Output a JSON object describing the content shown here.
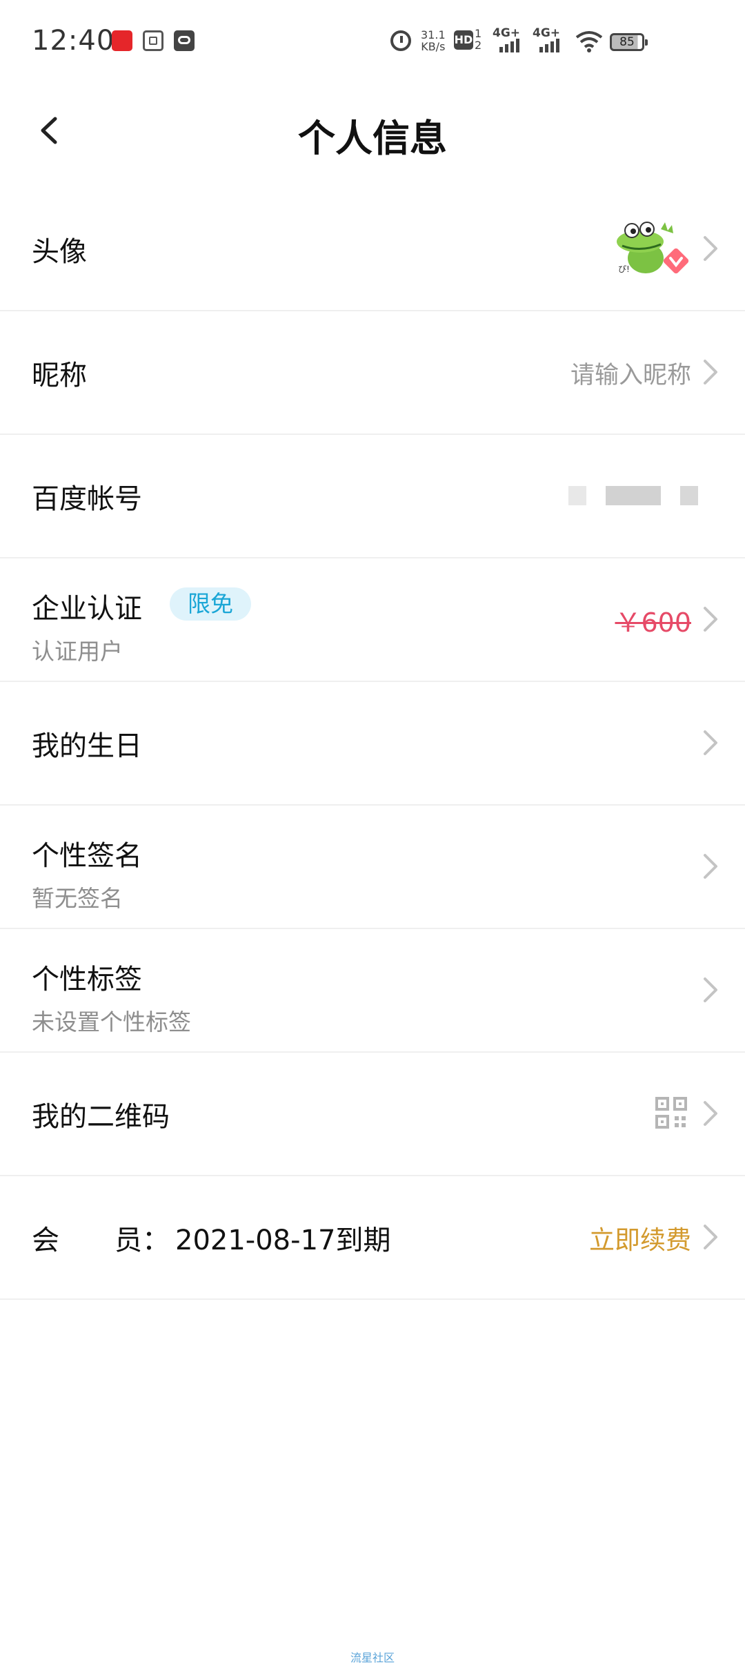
{
  "status_bar": {
    "time": "12:40",
    "net_speed_value": "31.1",
    "net_speed_unit": "KB/s",
    "hd_label": "HD",
    "hd_sub": "1 2",
    "signal1_label": "4G+",
    "signal2_label": "4G+",
    "battery": "85"
  },
  "header": {
    "title": "个人信息"
  },
  "rows": {
    "avatar": {
      "label": "头像"
    },
    "nickname": {
      "label": "昵称",
      "value": "请输入昵称"
    },
    "baidu_account": {
      "label": "百度帐号"
    },
    "enterprise": {
      "label": "企业认证",
      "badge": "限免",
      "sub": "认证用户",
      "price": "￥600"
    },
    "birthday": {
      "label": "我的生日"
    },
    "signature": {
      "label": "个性签名",
      "sub": "暂无签名"
    },
    "tags": {
      "label": "个性标签",
      "sub": "未设置个性标签"
    },
    "qrcode": {
      "label": "我的二维码"
    },
    "member": {
      "label": "会　　员：",
      "value": "2021-08-17到期",
      "action": "立即续费"
    }
  },
  "footer": {
    "watermark": "流星社区"
  },
  "colors": {
    "accent_blue": "#1aa6d6",
    "price_red": "#e64a67",
    "renew_gold": "#d39a2e"
  },
  "icons": [
    "back-arrow-icon",
    "chevron-right-icon",
    "qr-code-icon",
    "alarm-icon",
    "wifi-icon",
    "battery-icon"
  ]
}
